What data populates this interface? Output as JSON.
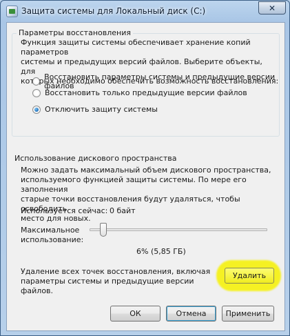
{
  "window": {
    "title": "Защита системы для Локальный диск (C:)",
    "close_glyph": "✕"
  },
  "restore_settings": {
    "legend": "Параметры восстановления",
    "description_lines": [
      "Функция защиты системы обеспечивает хранение копий параметров",
      "системы и предыдущих версий файлов. Выберите объекты, для",
      "которых необходимо обеспечить возможность восстановления:"
    ],
    "options": [
      {
        "label": "Восстановить параметры системы и предыдущие версии файлов",
        "checked": false
      },
      {
        "label": "Восстановить только предыдущие версии файлов",
        "checked": false
      },
      {
        "label": "Отключить защиту системы",
        "checked": true
      }
    ]
  },
  "disk_usage": {
    "legend": "Использование дискового пространства",
    "description_lines": [
      "Можно задать максимальный объем дискового пространства,",
      "используемого функцией защиты системы. По мере его заполнения",
      "старые точки восстановления будут удаляться, чтобы освободить",
      "место для новых."
    ],
    "current_label": "Используется сейчас:",
    "current_value": "0 байт",
    "max_label_lines": [
      "Максимальное",
      "использование:"
    ],
    "slider_value": 0.06,
    "slider_readout": "6% (5,85 ГБ)",
    "delete_text_lines": [
      "Удаление всех точек восстановления, включая",
      "параметры системы и предыдущие версии файлов."
    ],
    "delete_button": "Удалить"
  },
  "footer": {
    "ok": "ОК",
    "cancel": "Отмена",
    "apply": "Применить"
  },
  "colors": {
    "highlight": "#f5f123",
    "radio_selected": "#1e6fb8"
  }
}
